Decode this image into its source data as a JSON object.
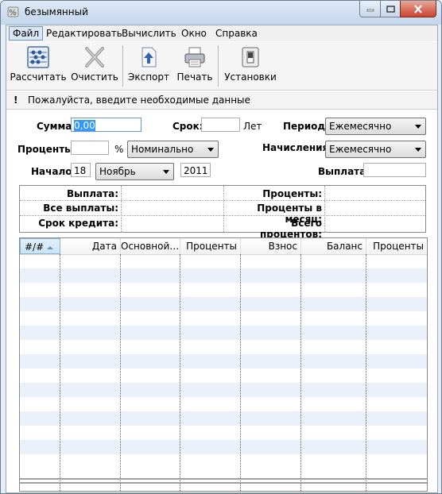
{
  "window": {
    "title": "безымянный"
  },
  "menu": {
    "items": [
      "Файл",
      "Редактировать",
      "Вычислить",
      "Окно",
      "Справка"
    ]
  },
  "toolbar": {
    "calculate": "Рассчитать",
    "clear": "Очистить",
    "export": "Экспорт",
    "print": "Печать",
    "settings": "Установки"
  },
  "hint": {
    "icon": "!",
    "text": "Пожалуйста, введите необходимые данные"
  },
  "form": {
    "amount_label": "Сумма:",
    "amount_value": "0,00",
    "term_label": "Срок:",
    "term_value": "",
    "term_unit": "Лет",
    "period_label": "Период:",
    "period_value": "Ежемесячно",
    "rate_label": "Проценты:",
    "rate_value": "",
    "rate_unit": "%",
    "rate_type_value": "Номинально",
    "compounding_label": "Начисления:",
    "compounding_value": "Ежемесячно",
    "start_label": "Начало:",
    "start_day": "18",
    "start_month": "Ноябрь",
    "start_year": "2011",
    "payment_label": "Выплата:",
    "payment_value": ""
  },
  "summary": {
    "payment_label": "Выплата:",
    "interest_label": "Проценты:",
    "total_payments_label": "Все выплаты:",
    "monthly_interest_label": "Проценты в месяц:",
    "loan_term_label": "Срок кредита:",
    "total_interest_label": "Всего процентов:"
  },
  "schedule": {
    "columns": [
      "#/#",
      "Дата",
      "Основной…",
      "Проценты",
      "Взнос",
      "Баланс",
      "Проценты"
    ],
    "rows": []
  }
}
